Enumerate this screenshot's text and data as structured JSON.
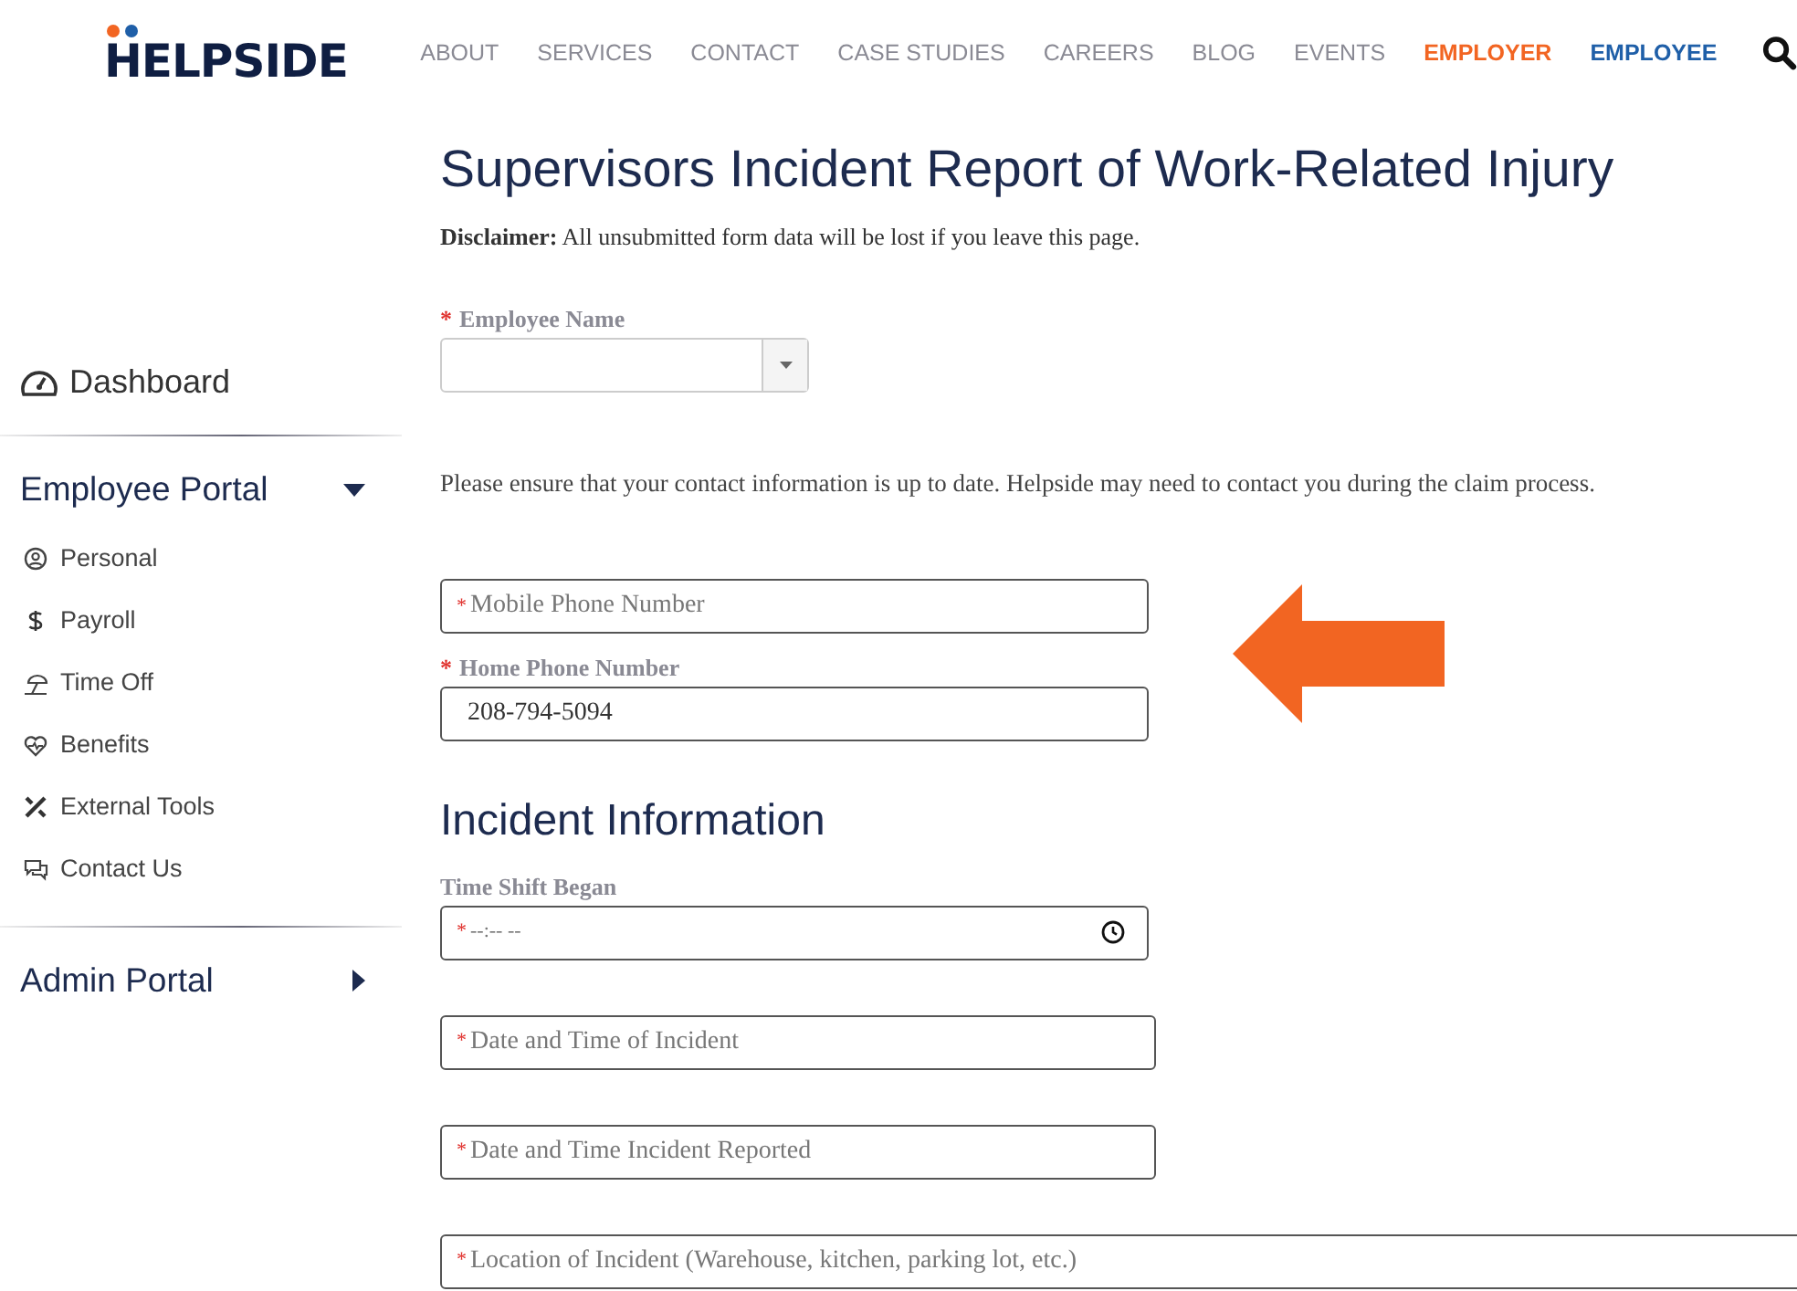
{
  "header": {
    "logo": "HELPSIDE",
    "nav": [
      {
        "label": "ABOUT",
        "color": "#8a8a94"
      },
      {
        "label": "SERVICES",
        "color": "#8a8a94"
      },
      {
        "label": "CONTACT",
        "color": "#8a8a94"
      },
      {
        "label": "CASE STUDIES",
        "color": "#8a8a94"
      },
      {
        "label": "CAREERS",
        "color": "#8a8a94"
      },
      {
        "label": "BLOG",
        "color": "#8a8a94"
      },
      {
        "label": "EVENTS",
        "color": "#8a8a94"
      },
      {
        "label": "EMPLOYER",
        "color": "#f26522"
      },
      {
        "label": "EMPLOYEE",
        "color": "#1f5fa8"
      }
    ]
  },
  "sidebar": {
    "dashboard": {
      "label": "Dashboard"
    },
    "sections": [
      {
        "title": "Employee Portal",
        "expanded": true,
        "items": [
          {
            "label": "Personal",
            "kind": "person"
          },
          {
            "label": "Payroll",
            "kind": "dollar"
          },
          {
            "label": "Time Off",
            "kind": "umbrella"
          },
          {
            "label": "Benefits",
            "kind": "heart"
          },
          {
            "label": "External Tools",
            "kind": "tools"
          },
          {
            "label": "Contact Us",
            "kind": "chat"
          }
        ]
      },
      {
        "title": "Admin Portal",
        "expanded": false
      }
    ]
  },
  "main": {
    "title": "Supervisors Incident Report of Work-Related Injury",
    "disclaimer": "**Disclaimer:** All unsubmitted form data will be lost if you leave this page.",
    "blocks": [
      {
        "kind": "select",
        "label": "Employee Name",
        "required_mark": "*"
      },
      {
        "kind": "paragraph",
        "text": "Please ensure that your contact information is up to date. Helpside may need to contact you during the claim process."
      },
      {
        "kind": "text",
        "placeholder": "Mobile Phone Number",
        "required_mark": "*"
      },
      {
        "kind": "text",
        "label": "Home Phone Number",
        "required_mark": "*",
        "value": "208-794-5094"
      },
      {
        "kind": "heading",
        "text": "Incident Information"
      },
      {
        "kind": "time",
        "label": "Time Shift Began",
        "placeholder": "--:-- --",
        "required_mark": "*"
      },
      {
        "kind": "text",
        "placeholder": "Date and Time of Incident",
        "required_mark": "*",
        "wide": true
      },
      {
        "kind": "text",
        "placeholder": "Date and Time Incident Reported",
        "required_mark": "*",
        "wide": true
      },
      {
        "kind": "text",
        "placeholder": "Location of Incident (Warehouse, kitchen, parking lot, etc.)",
        "required_mark": "*",
        "full": true
      }
    ]
  }
}
